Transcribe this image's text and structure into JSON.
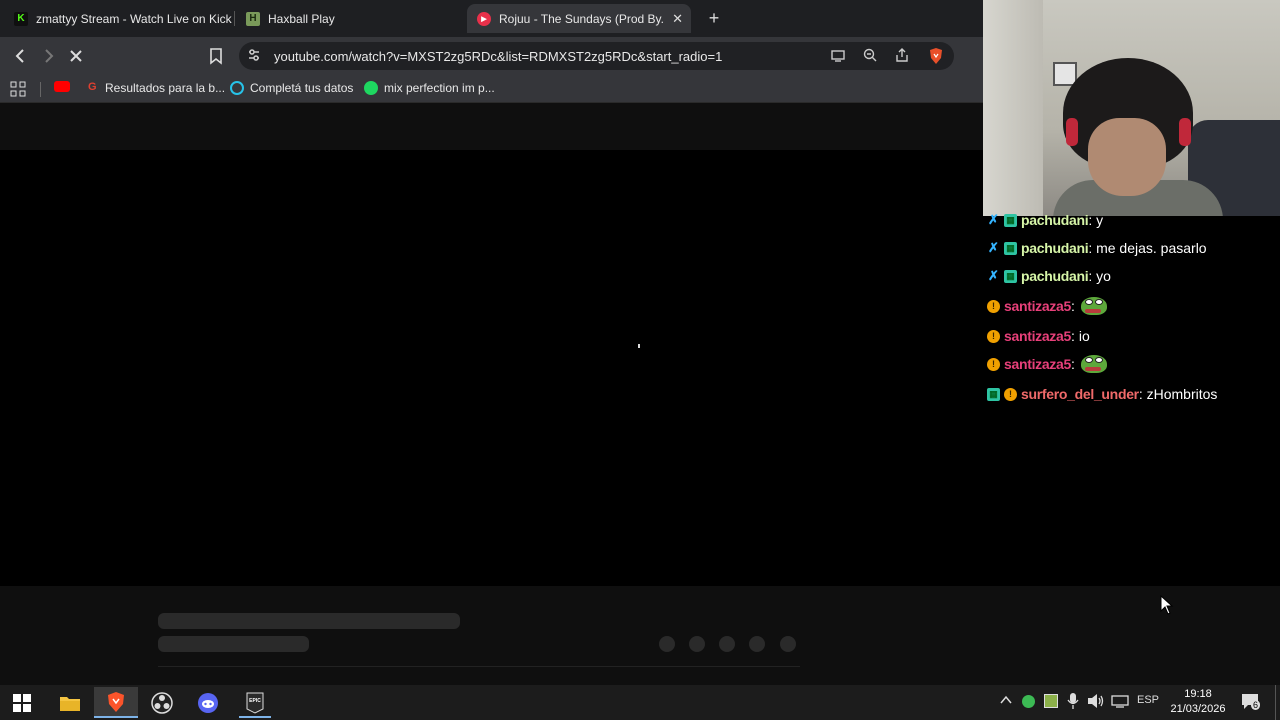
{
  "browser": {
    "tabs": [
      {
        "title": "zmattyy Stream - Watch Live on Kick",
        "icon": "kick-icon",
        "active": false
      },
      {
        "title": "Haxball Play",
        "icon": "haxball-icon",
        "active": false
      },
      {
        "title": "Rojuu - The Sundays (Prod By. Ev",
        "icon": "youtube-music-icon",
        "active": true
      }
    ],
    "url": "youtube.com/watch?v=MXST2zg5RDc&list=RDMXST2zg5RDc&start_radio=1",
    "bookmarks": [
      {
        "label": "",
        "icon": "youtube-icon"
      },
      {
        "label": "Resultados para la b...",
        "icon": "google-icon"
      },
      {
        "label": "Completá tus datos",
        "icon": "circle-icon"
      },
      {
        "label": "mix perfection im p...",
        "icon": "spotify-icon"
      }
    ]
  },
  "chat": {
    "messages": [
      {
        "user": "pachudani",
        "user_color": "#d6f5a8",
        "badges": [
          "sword",
          "grid"
        ],
        "text": "y",
        "emote": false
      },
      {
        "user": "pachudani",
        "user_color": "#d6f5a8",
        "badges": [
          "sword",
          "grid"
        ],
        "text": "me dejas. pasarlo",
        "emote": false
      },
      {
        "user": "pachudani",
        "user_color": "#d6f5a8",
        "badges": [
          "sword",
          "grid"
        ],
        "text": "yo",
        "emote": false
      },
      {
        "user": "santizaza5",
        "user_color": "#e8407a",
        "badges": [
          "sub"
        ],
        "text": "",
        "emote": true
      },
      {
        "user": "santizaza5",
        "user_color": "#e8407a",
        "badges": [
          "sub"
        ],
        "text": "io",
        "emote": false
      },
      {
        "user": "santizaza5",
        "user_color": "#e8407a",
        "badges": [
          "sub"
        ],
        "text": "",
        "emote": true
      },
      {
        "user": "surfero_del_under",
        "user_color": "#f06a6a",
        "badges": [
          "grid",
          "sub"
        ],
        "text": "zHombritos",
        "emote": false
      }
    ]
  },
  "taskbar": {
    "apps": [
      "windows-start-icon",
      "file-explorer-icon",
      "brave-icon",
      "obs-icon",
      "discord-icon",
      "epic-games-icon"
    ],
    "language": "ESP",
    "time": "19:18",
    "date": "21/03/2026",
    "notification_count": "6"
  }
}
